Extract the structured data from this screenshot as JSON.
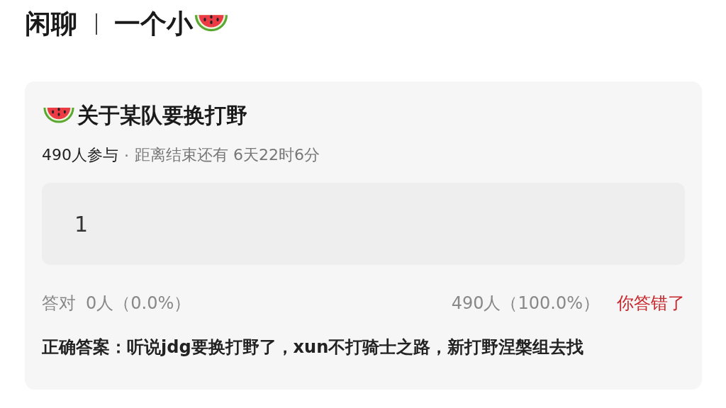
{
  "header": {
    "channel": "闲聊",
    "title": "一个小"
  },
  "poll": {
    "title": "关于某队要换打野",
    "participants": "490人参与",
    "separator": "·",
    "deadline": "距离结束还有 6天22时6分",
    "options": [
      {
        "label": "1"
      }
    ],
    "stats": {
      "correct_label": "答对",
      "correct_count": "0人（0.0%）",
      "wrong_count": "490人（100.0%）",
      "result": "你答错了"
    },
    "answer": "正确答案：听说jdg要换打野了，xun不打骑士之路，新打野涅槃组去找"
  }
}
